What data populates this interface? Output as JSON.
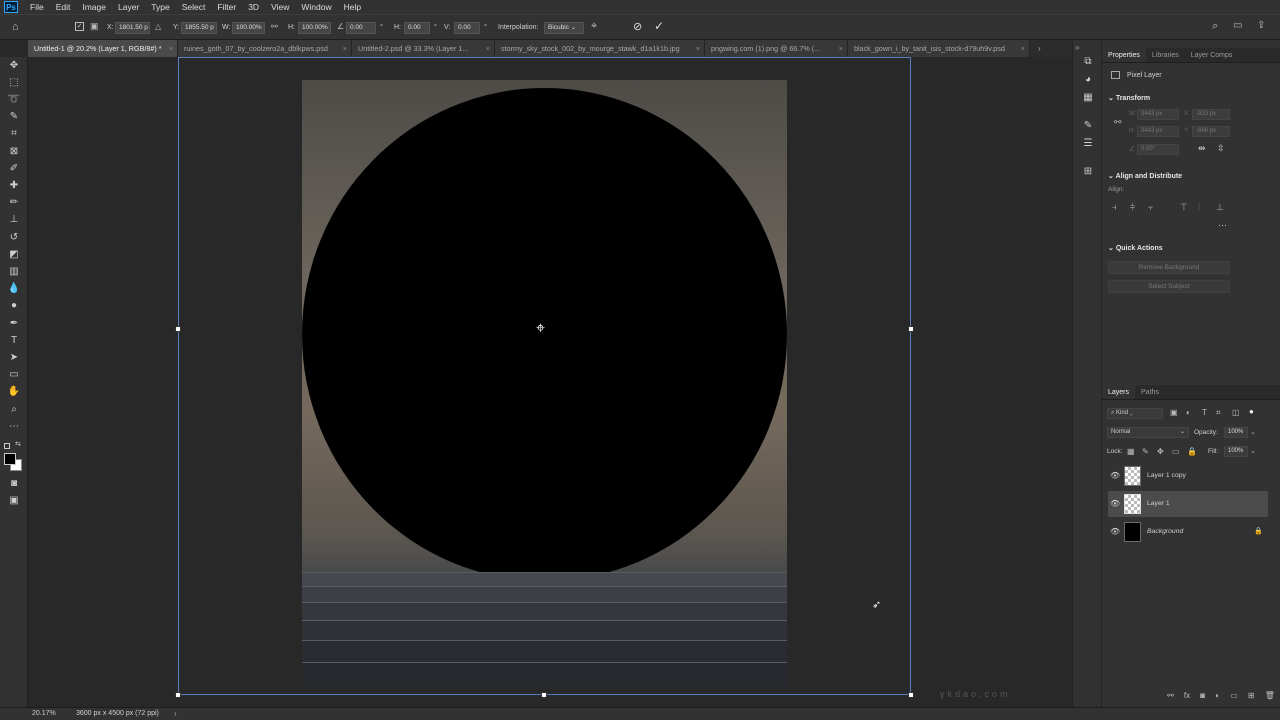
{
  "app": {
    "logo_text": "Ps"
  },
  "menu": [
    "File",
    "Edit",
    "Image",
    "Layer",
    "Type",
    "Select",
    "Filter",
    "3D",
    "View",
    "Window",
    "Help"
  ],
  "options": {
    "x_label": "X:",
    "x_value": "1801.50 p",
    "y_label": "Y:",
    "y_value": "1855.50 p",
    "w_label": "W:",
    "w_value": "100.00%",
    "h_label": "H:",
    "h_value": "100.00%",
    "angle_value": "0.00",
    "angle_unit": "°",
    "hskew_label": "H:",
    "hskew_value": "0.00",
    "hskew_unit": "°",
    "vskew_label": "V:",
    "vskew_value": "0.00",
    "vskew_unit": "°",
    "interp_label": "Interpolation:",
    "interp_value": "Bicubic"
  },
  "tabs": [
    {
      "label": "Untitled-1 @ 20.2% (Layer 1, RGB/8#) *",
      "active": true
    },
    {
      "label": "ruines_goth_07_by_coolzero2a_dblkpws.psd",
      "active": false
    },
    {
      "label": "Untitled-2.psd @ 33.3% (Layer 1...",
      "active": false
    },
    {
      "label": "stormy_sky_stock_002_by_mourge_stawk_d1a1k1b.jpg",
      "active": false
    },
    {
      "label": "pngwing.com (1).png @ 66.7% (...",
      "active": false
    },
    {
      "label": "black_gown_i_by_tanit_isis_stock-d79uh9v.psd",
      "active": false
    }
  ],
  "tab_close_glyph": "×",
  "properties": {
    "tabs": [
      "Properties",
      "Libraries",
      "Layer Comps"
    ],
    "kind": "Pixel Layer",
    "transform_title": "Transform",
    "w_label": "W:",
    "w_value": "3443 px",
    "x_label": "X:",
    "x_value": "-920 px",
    "h_label": "H:",
    "h_value": "3443 px",
    "y_label": "Y:",
    "y_value": "-866 px",
    "angle_value": "0.00°",
    "align_title": "Align and Distribute",
    "align_label": "Align:",
    "quick_title": "Quick Actions",
    "remove_bg": "Remove Background",
    "select_subject": "Select Subject"
  },
  "layers_panel": {
    "tabs": [
      "Layers",
      "Paths"
    ],
    "filter": "Kind",
    "blend": "Normal",
    "opacity_label": "Opacity:",
    "opacity_value": "100%",
    "lock_label": "Lock:",
    "fill_label": "Fill:",
    "fill_value": "100%",
    "layers": [
      {
        "name": "Layer 1 copy",
        "selected": false
      },
      {
        "name": "Layer 1",
        "selected": true
      },
      {
        "name": "Background",
        "selected": false
      }
    ]
  },
  "status": {
    "zoom": "20.17%",
    "doc_info": "3600 px x 4500 px (72 ppi)"
  },
  "watermark": "ykdao.com"
}
